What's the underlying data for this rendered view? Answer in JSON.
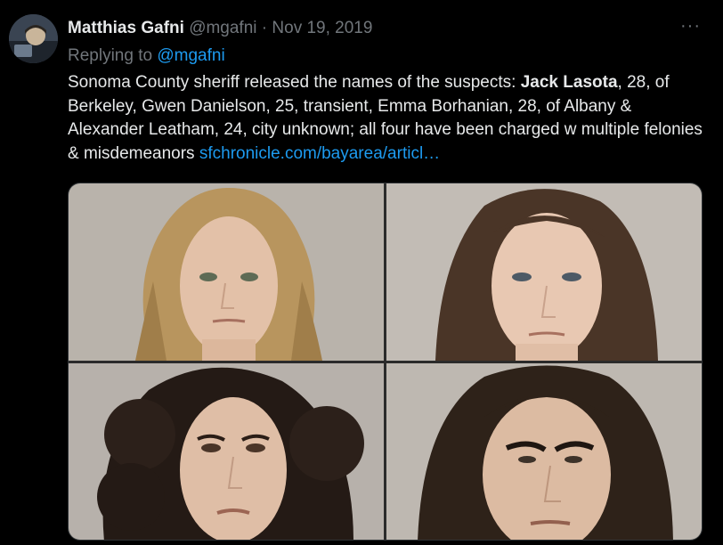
{
  "tweet": {
    "author_name": "Matthias Gafni",
    "author_handle": "@mgafni",
    "separator": "·",
    "date": "Nov 19, 2019",
    "more_icon": "more-horizontal-icon",
    "replying_prefix": "Replying to ",
    "replying_handle": "@mgafni",
    "text_part1": "Sonoma County sheriff released the names of the suspects: ",
    "text_bold": "Jack Lasota",
    "text_part2": ", 28, of Berkeley, Gwen Danielson, 25, transient, Emma Borhanian, 28, of Albany & Alexander Leatham, 24, city unknown; all four have been charged w multiple felonies & misdemeanors ",
    "link_text": "sfchronicle.com/bayarea/articl…"
  },
  "colors": {
    "background": "#000000",
    "text": "#e7e9ea",
    "secondary": "#71767b",
    "link": "#1d9bf0"
  }
}
